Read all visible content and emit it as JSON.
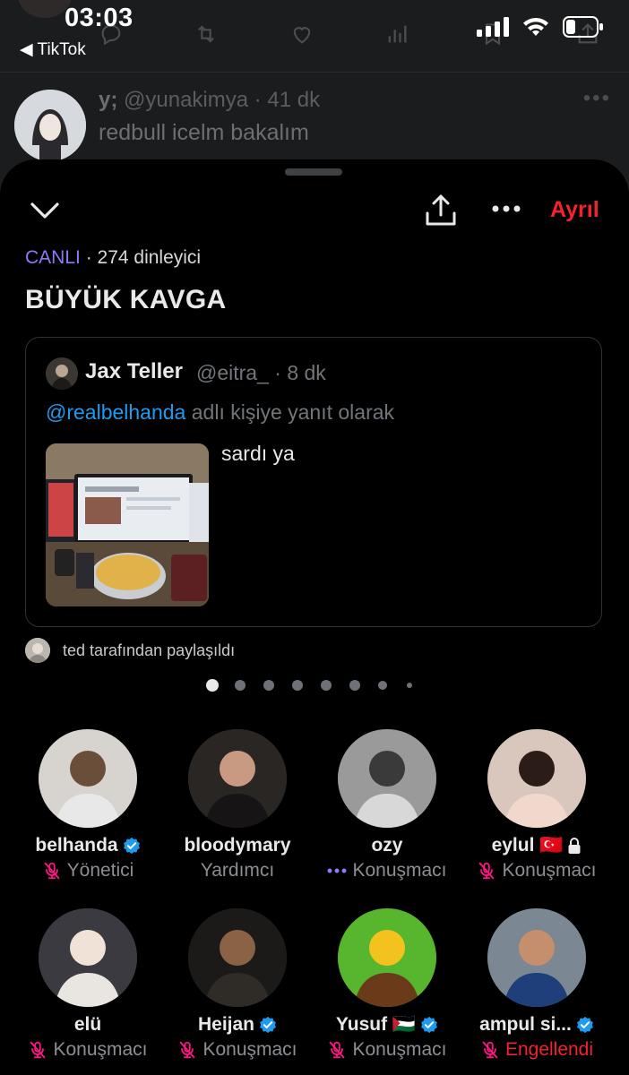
{
  "status": {
    "time": "03:03",
    "back_app": "◀ TikTok"
  },
  "background_post": {
    "display_name": "y;",
    "handle": "@yunakimya · 41 dk",
    "text": "redbull icelm bakalım"
  },
  "header": {
    "leave_label": "Ayrıl"
  },
  "space": {
    "live_label": "CANLI",
    "listeners": "· 274 dinleyici",
    "title": "BÜYÜK KAVGA"
  },
  "pinned_post": {
    "display_name": "Jax Teller",
    "handle": "@eitra_ · 8 dk",
    "reply_mention": "@realbelhanda",
    "reply_suffix": " adlı kişiye yanıt olarak",
    "text": "sardı ya"
  },
  "shared_by": "ted tarafından paylaşıldı",
  "pager": {
    "count": 8,
    "active": 0
  },
  "participants": [
    {
      "name": "belhanda",
      "role": "Yönetici",
      "verified": true,
      "role_icon": "mic-off-icon"
    },
    {
      "name": "bloodymary",
      "role": "Yardımcı",
      "verified": false,
      "role_icon": ""
    },
    {
      "name": "ozy",
      "role": "Konuşmacı",
      "verified": false,
      "role_icon": "speaking-dots-icon"
    },
    {
      "name": "eylul 🇹🇷",
      "role": "Konuşmacı",
      "verified": false,
      "role_icon": "mic-off-icon",
      "extra_icon": "lock-icon"
    },
    {
      "name": "elü",
      "role": "Konuşmacı",
      "verified": false,
      "role_icon": "mic-off-icon"
    },
    {
      "name": "Heijan",
      "role": "Konuşmacı",
      "verified": true,
      "role_icon": "mic-off-icon"
    },
    {
      "name": "Yusuf 🇵🇸",
      "role": "Konuşmacı",
      "verified": true,
      "role_icon": "mic-off-icon"
    },
    {
      "name": "ampul si...",
      "role": "Engellendi",
      "verified": true,
      "role_icon": "mic-off-icon"
    }
  ],
  "colors": {
    "accent_purple": "#8b7bf6",
    "danger_red": "#f4212e",
    "link_blue": "#1d9bf0",
    "mic_off_pink": "#f91880"
  }
}
